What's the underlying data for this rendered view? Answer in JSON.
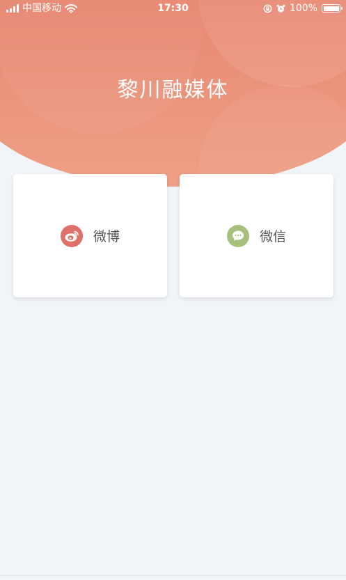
{
  "status_bar": {
    "carrier": "中国移动",
    "time": "17:30",
    "battery": "100%"
  },
  "header": {
    "title": "黎川融媒体"
  },
  "cards": [
    {
      "label": "微博",
      "icon": "weibo-icon",
      "color": "#e0716a"
    },
    {
      "label": "微信",
      "icon": "wechat-icon",
      "color": "#a6c17c"
    }
  ],
  "colors": {
    "header_top": "#df7866",
    "header_bottom": "#eea086",
    "page_background": "#f1f4f8"
  }
}
